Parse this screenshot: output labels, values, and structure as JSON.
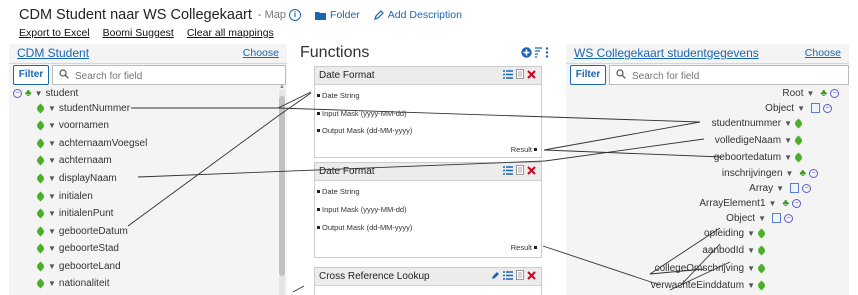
{
  "header": {
    "title": "CDM Student naar WS Collegekaart",
    "subtitle": "- Map",
    "folder_label": "Folder",
    "add_description_label": "Add Description",
    "links": [
      "Export to Excel",
      "Boomi Suggest",
      "Clear all mappings"
    ]
  },
  "left": {
    "title": "CDM Student",
    "choose": "Choose",
    "filter_label": "Filter",
    "search_placeholder": "Search for field",
    "items": [
      "student",
      "studentNummer",
      "voornamen",
      "achternaamVoegsel",
      "achternaam",
      "displayNaam",
      "initialen",
      "initialenPunt",
      "geboorteDatum",
      "geboorteStad",
      "geboorteLand",
      "nationaliteit"
    ]
  },
  "functions": {
    "title": "Functions",
    "boxes": [
      {
        "name": "Date Format",
        "inputs": [
          "Date String",
          "Input Mask (yyyy-MM-dd)",
          "Output Mask (dd-MM-yyyy)"
        ],
        "output": "Result"
      },
      {
        "name": "Date Format",
        "inputs": [
          "Date String",
          "Input Mask (yyyy-MM-dd)",
          "Output Mask (dd-MM-yyyy)"
        ],
        "output": "Result"
      },
      {
        "name": "Cross Reference Lookup"
      }
    ]
  },
  "right": {
    "title": "WS Collegekaart studentgegevens",
    "choose": "Choose",
    "filter_label": "Filter",
    "search_placeholder": "Search for field",
    "items": [
      "Root",
      "Object",
      "studentnummer",
      "volledigeNaam",
      "geboortedatum",
      "inschrijvingen",
      "Array",
      "ArrayElement1",
      "Object",
      "opleiding",
      "aanbodId",
      "collegeOmschrijving",
      "verwachteEinddatum"
    ]
  },
  "colors": {
    "accent": "#1a66b3",
    "leaf": "#4caf2a",
    "delete": "#d0021b"
  }
}
